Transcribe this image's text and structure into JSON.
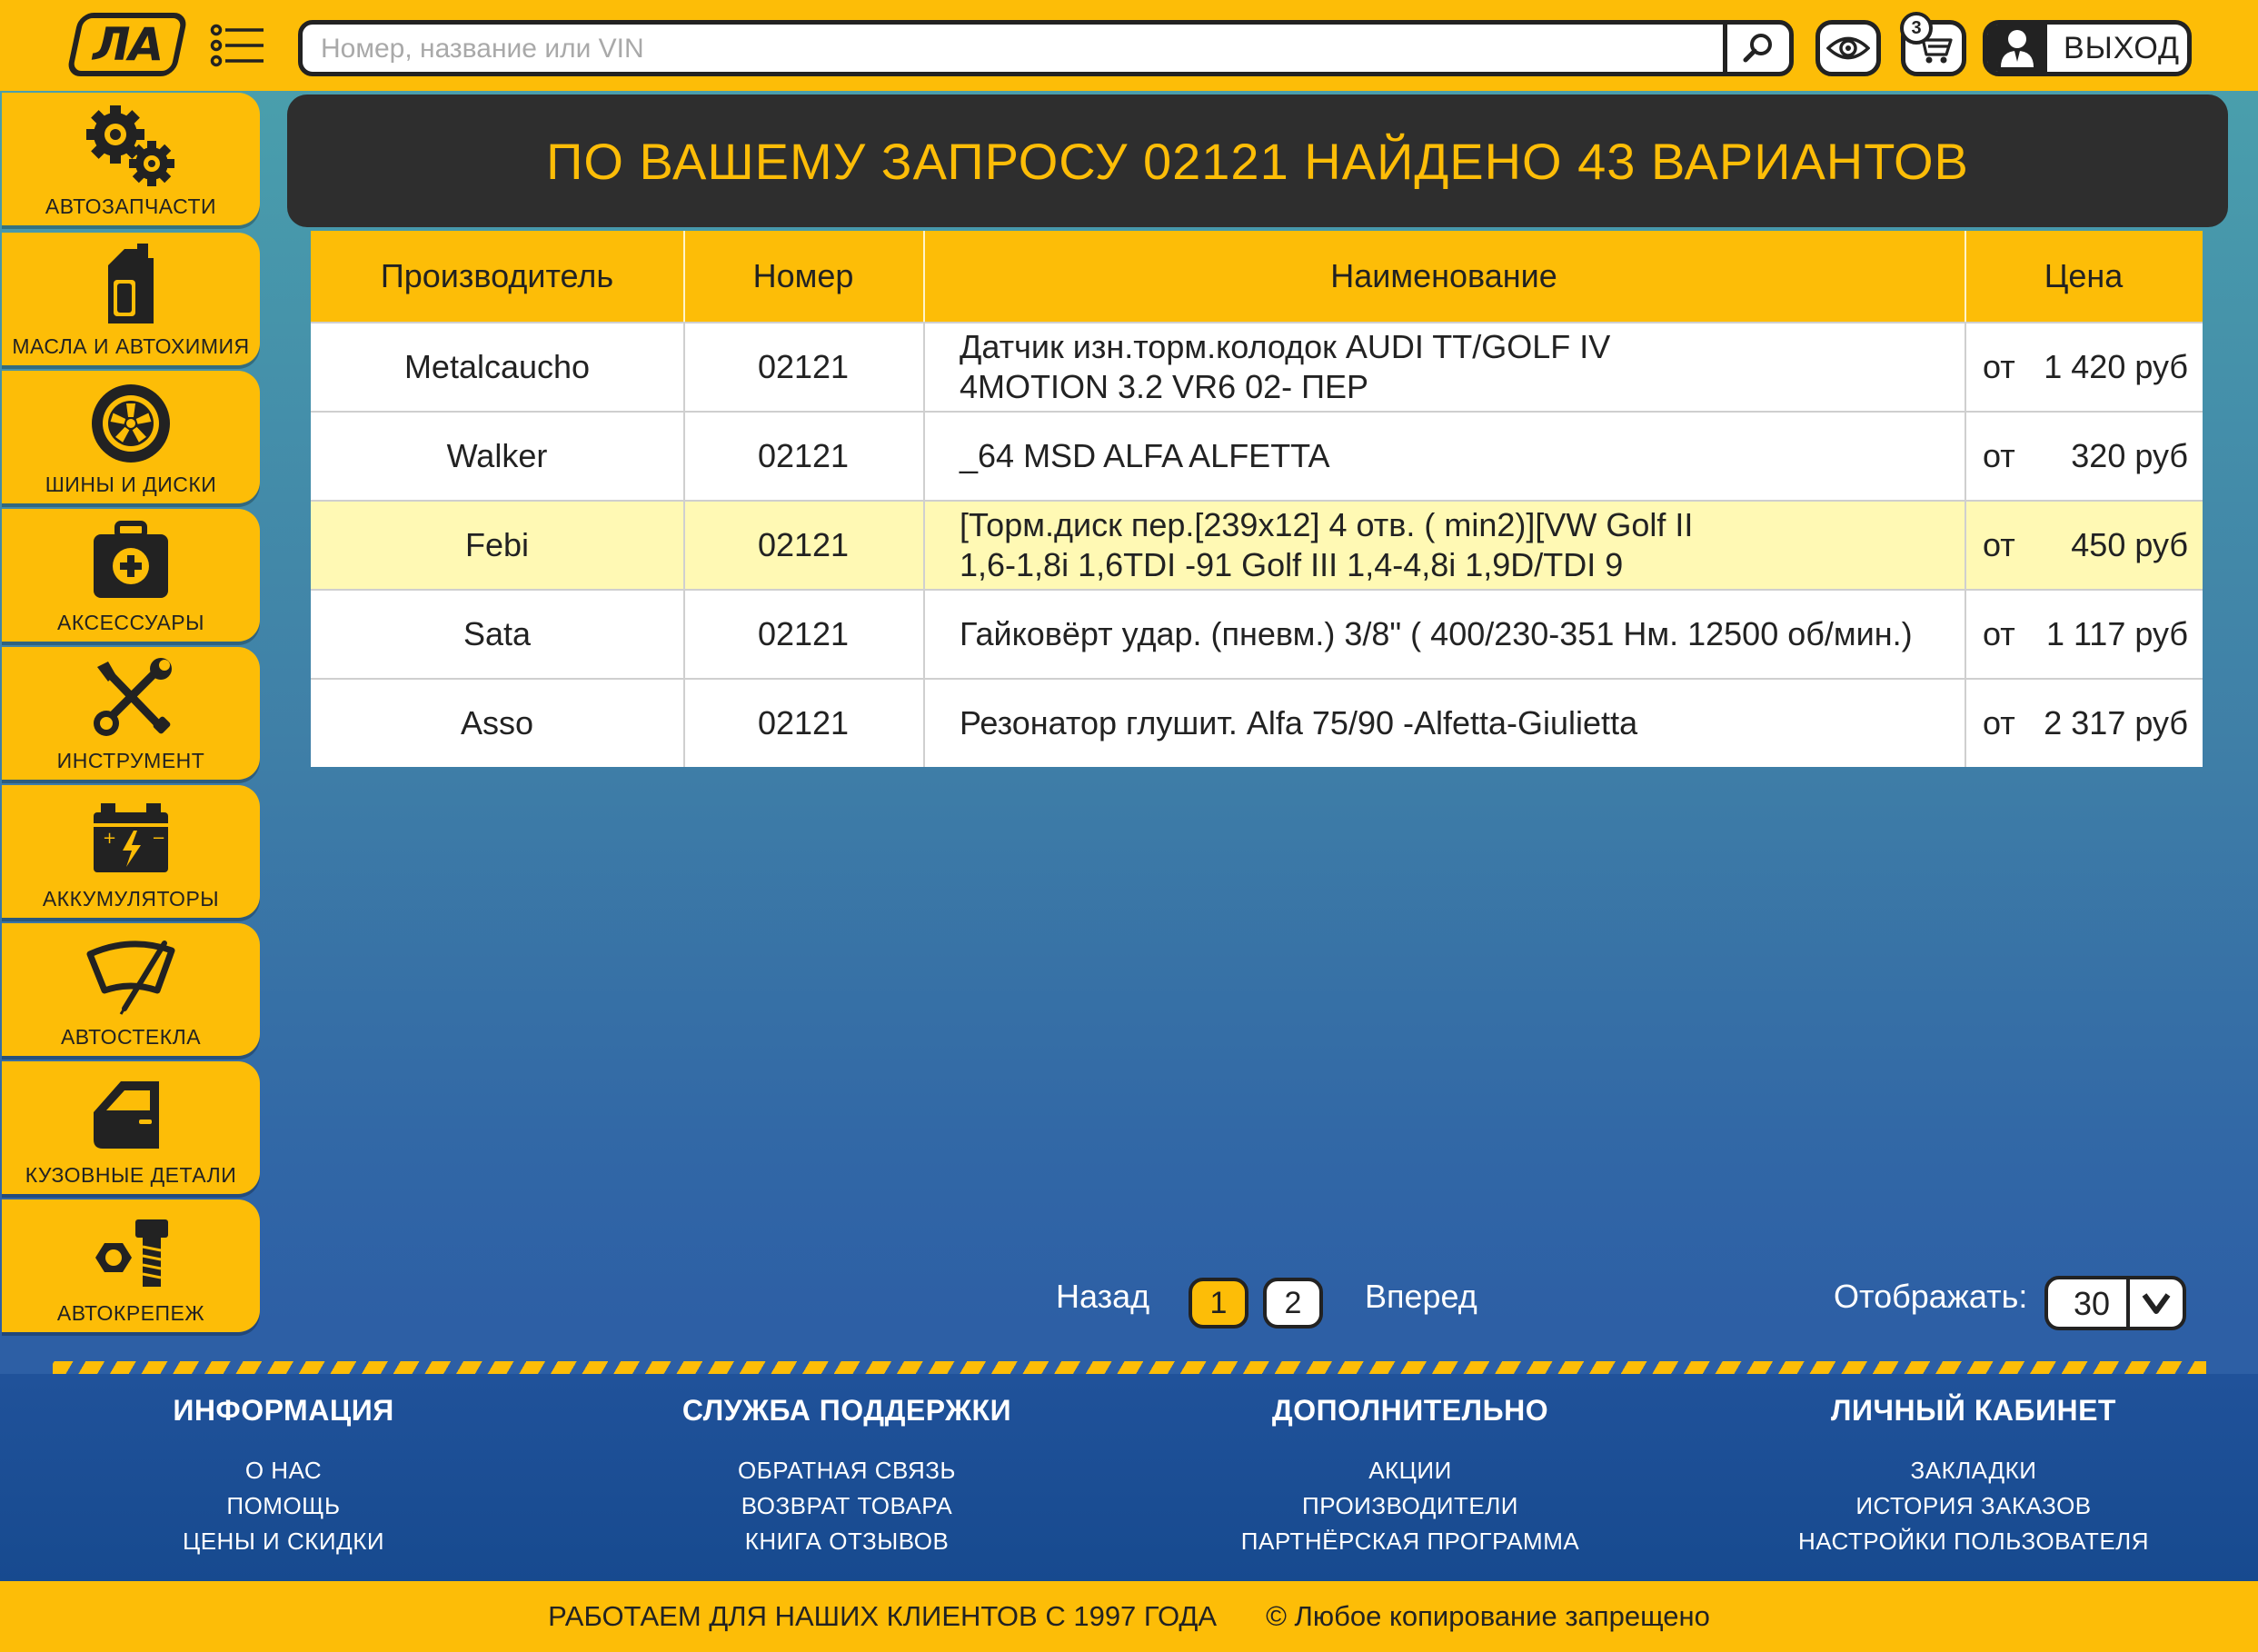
{
  "header": {
    "logo_text": "ЛА",
    "search_placeholder": "Номер, название или VIN",
    "cart_count": "3",
    "logout_label": "ВЫХОД"
  },
  "sidebar": {
    "items": [
      {
        "label": "АВТОЗАПЧАСТИ",
        "icon": "gears-icon"
      },
      {
        "label": "МАСЛА И АВТОХИМИЯ",
        "icon": "oil-canister-icon"
      },
      {
        "label": "ШИНЫ И ДИСКИ",
        "icon": "wheel-icon"
      },
      {
        "label": "АКСЕССУАРЫ",
        "icon": "first-aid-kit-icon"
      },
      {
        "label": "ИНСТРУМЕНТ",
        "icon": "tools-icon"
      },
      {
        "label": "АККУМУЛЯТОРЫ",
        "icon": "battery-icon"
      },
      {
        "label": "АВТОСТЕКЛА",
        "icon": "windshield-icon"
      },
      {
        "label": "КУЗОВНЫЕ ДЕТАЛИ",
        "icon": "car-door-icon"
      },
      {
        "label": "АВТОКРЕПЕЖ",
        "icon": "bolt-nut-icon"
      }
    ]
  },
  "banner": {
    "title": "ПО ВАШЕМУ ЗАПРОСУ 02121 НАЙДЕНО 43 ВАРИАНТОВ"
  },
  "table": {
    "headers": {
      "manufacturer": "Производитель",
      "number": "Номер",
      "name": "Наименование",
      "price": "Цена"
    },
    "rows": [
      {
        "manufacturer": "Metalcaucho",
        "number": "02121",
        "name_line1": "Датчик изн.торм.колодок AUDI TT/GOLF IV",
        "name_line2": "4MOTION 3.2 VR6 02- ПЕР",
        "price_prefix": "от",
        "price": "1 420 руб"
      },
      {
        "manufacturer": "Walker",
        "number": "02121",
        "name_line1": "_64 MSD ALFA ALFETTA",
        "name_line2": "",
        "price_prefix": "от",
        "price": "320 руб"
      },
      {
        "manufacturer": "Febi",
        "number": "02121",
        "name_line1": "[Торм.диск пер.[239x12] 4 отв. ( min2)][VW Golf II",
        "name_line2": "1,6-1,8i 1,6TDI -91 Golf III 1,4-4,8i 1,9D/TDI 9",
        "price_prefix": "от",
        "price": "450 руб"
      },
      {
        "manufacturer": "Sata",
        "number": "02121",
        "name_line1": "Гайковёрт удар. (пневм.) 3/8\" ( 400/230-351 Нм. 12500 об/мин.)",
        "name_line2": "",
        "price_prefix": "от",
        "price": "1 117 руб"
      },
      {
        "manufacturer": "Asso",
        "number": "02121",
        "name_line1": "Резонатор глушит. Alfa 75/90 -Alfetta-Giulietta",
        "name_line2": "",
        "price_prefix": "от",
        "price": "2 317 руб"
      }
    ],
    "highlighted_row": "Febi"
  },
  "pagination": {
    "prev_label": "Назад",
    "pages": [
      "1",
      "2"
    ],
    "current_page": "1",
    "next_label": "Вперед",
    "show_label": "Отображать:",
    "per_page": "30"
  },
  "footer": {
    "columns": [
      {
        "title": "ИНФОРМАЦИЯ",
        "links": [
          "О НАС",
          "ПОМОЩЬ",
          "ЦЕНЫ И СКИДКИ"
        ]
      },
      {
        "title": "СЛУЖБА ПОДДЕРЖКИ",
        "links": [
          "ОБРАТНАЯ СВЯЗЬ",
          "ВОЗВРАТ ТОВАРА",
          "КНИГА ОТЗЫВОВ"
        ]
      },
      {
        "title": "ДОПОЛНИТЕЛЬНО",
        "links": [
          "АКЦИИ",
          "ПРОИЗВОДИТЕЛИ",
          "ПАРТНЁРСКАЯ ПРОГРАММА"
        ]
      },
      {
        "title": "ЛИЧНЫЙ КАБИНЕТ",
        "links": [
          "ЗАКЛАДКИ",
          "ИСТОРИЯ ЗАКАЗОВ",
          "НАСТРОЙКИ ПОЛЬЗОВАТЕЛЯ"
        ]
      }
    ],
    "since_text": "РАБОТАЕМ ДЛЯ НАШИХ КЛИЕНТОВ С 1997 ГОДА",
    "copyright_text": "©  Любое копирование запрещено"
  },
  "colors": {
    "accent_yellow": "#fdbd07",
    "dark": "#2e2e2e",
    "highlight_row": "#fff9b4",
    "footer_blue": "#1c4f96"
  }
}
